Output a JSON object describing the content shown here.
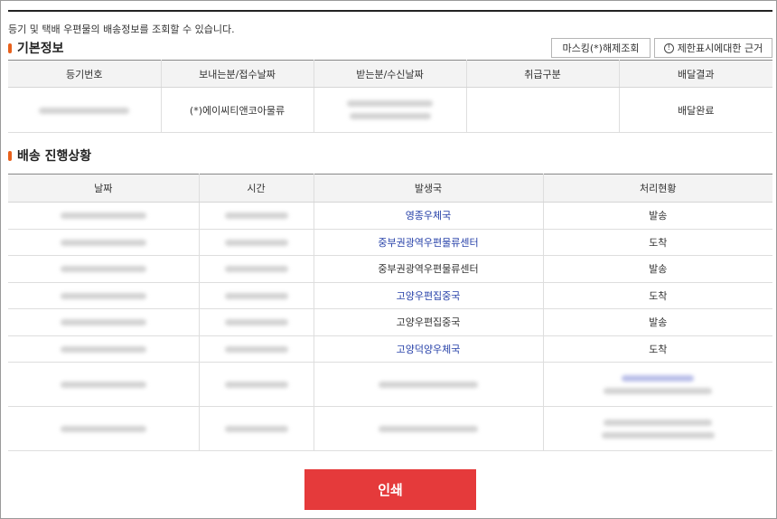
{
  "intro_text": "등기 및 택배 우편물의 배송정보를 조회할 수 있습니다.",
  "basic": {
    "title": "기본정보",
    "unmask_button": "마스킹(*)해제조회",
    "mask_basis_button": "제한표시에대한 근거",
    "info_glyph": "!",
    "headers": [
      "등기번호",
      "보내는분/접수날짜",
      "받는분/수신날짜",
      "취급구분",
      "배달결과"
    ],
    "row": {
      "sender": "(*)에이씨티앤코아물류",
      "handling": "",
      "result": "배달완료"
    }
  },
  "progress": {
    "title": "배송 진행상황",
    "headers": [
      "날짜",
      "시간",
      "발생국",
      "처리현황"
    ],
    "rows": [
      {
        "office": "영종우체국",
        "office_link": true,
        "status": "발송"
      },
      {
        "office": "중부권광역우편물류센터",
        "office_link": true,
        "status": "도착"
      },
      {
        "office": "중부권광역우편물류센터",
        "office_link": false,
        "status": "발송"
      },
      {
        "office": "고양우편집중국",
        "office_link": true,
        "status": "도착"
      },
      {
        "office": "고양우편집중국",
        "office_link": false,
        "status": "발송"
      },
      {
        "office": "고양덕양우체국",
        "office_link": true,
        "status": "도착"
      }
    ]
  },
  "print_button": "인쇄",
  "colors": {
    "accent_bar": "#e8611c",
    "link": "#2640a8",
    "print_button": "#e53a3b"
  },
  "icons": {
    "info": "info-circle-icon",
    "section_marker": "section-marker-icon"
  }
}
